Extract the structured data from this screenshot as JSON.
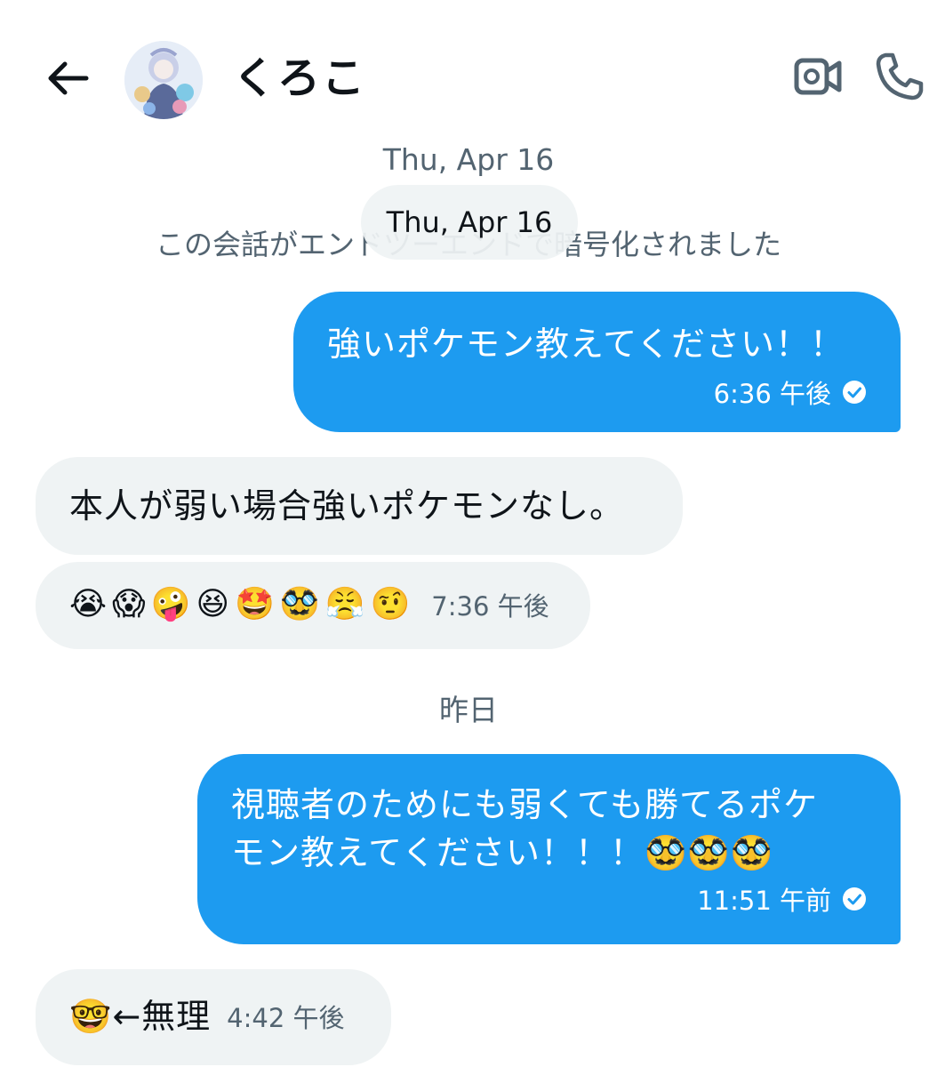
{
  "header": {
    "back_icon": "arrow-left-icon",
    "contact_name": "くろこ",
    "video_icon": "video-call-icon",
    "call_icon": "phone-icon"
  },
  "dates": {
    "first": "Thu, Apr 16",
    "sticky": "Thu, Apr 16",
    "second": "昨日"
  },
  "encryption_notice": "この会話がエンドツーエンドで暗号化されました",
  "messages": [
    {
      "type": "sent",
      "text": "強いポケモン教えてください！！",
      "time": "6:36 午後"
    },
    {
      "type": "received",
      "text": "本人が弱い場合強いポケモンなし。"
    },
    {
      "type": "received",
      "emojis": [
        "😭",
        "😱",
        "🤪",
        "😆",
        "🤩",
        "🥸",
        "😤",
        "🤨"
      ],
      "time": "7:36 午後"
    },
    {
      "type": "sent",
      "line1": "視聴者のためにも弱くても勝てるポケ",
      "line2": "モン教えてください！！！🥸🥸🥸",
      "time": "11:51 午前"
    },
    {
      "type": "received",
      "text": "🤓←無理",
      "time": "4:42 午後"
    }
  ],
  "colors": {
    "sent_bubble": "#1d9bf0",
    "received_bubble": "#eff3f4",
    "secondary_text": "#536471"
  }
}
